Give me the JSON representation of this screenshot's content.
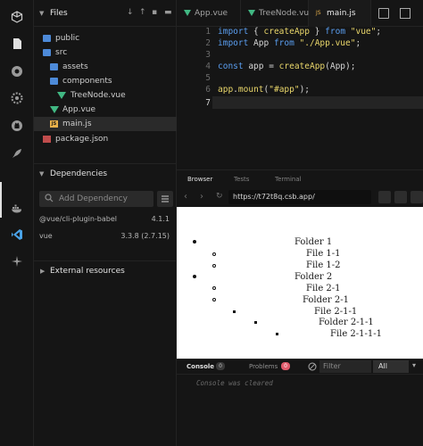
{
  "activity_bar": {
    "icons": [
      "cube-icon",
      "file-icon",
      "search-icon",
      "settings-icon",
      "github-icon",
      "rocket-icon",
      "docker-icon",
      "vscode-icon",
      "sparkle-icon"
    ]
  },
  "sidebar": {
    "title": "Files",
    "tree": [
      {
        "label": "public",
        "type": "folder"
      },
      {
        "label": "src",
        "type": "folder"
      },
      {
        "label": "assets",
        "type": "folder"
      },
      {
        "label": "components",
        "type": "folder"
      },
      {
        "label": "TreeNode.vue",
        "type": "vue"
      },
      {
        "label": "App.vue",
        "type": "vue"
      },
      {
        "label": "main.js",
        "type": "js"
      },
      {
        "label": "package.json",
        "type": "json"
      }
    ],
    "dependencies_title": "Dependencies",
    "add_dependency_placeholder": "Add Dependency",
    "dependencies": [
      {
        "name": "@vue/cli-plugin-babel",
        "version": "4.1.1"
      },
      {
        "name": "vue",
        "version": "3.3.8 (2.7.15)"
      }
    ],
    "external_resources_title": "External resources"
  },
  "editor": {
    "tabs": [
      {
        "label": "App.vue",
        "icon": "vue"
      },
      {
        "label": "TreeNode.vue",
        "icon": "vue"
      },
      {
        "label": "main.js",
        "icon": "js",
        "active": true
      }
    ],
    "line_numbers": [
      "1",
      "2",
      "3",
      "4",
      "5",
      "6",
      "7"
    ],
    "code": {
      "l1_kw": "import",
      "l1_mid": " { ",
      "l1_fn": "createApp",
      "l1_end": " } ",
      "l1_from": "from",
      "l1_str": " \"vue\"",
      "l1_semi": ";",
      "l2_kw": "import",
      "l2_mid": " App ",
      "l2_from": "from",
      "l2_str": " \"./App.vue\"",
      "l2_semi": ";",
      "l4_kw": "const",
      "l4_mid": " app = ",
      "l4_fn": "createApp",
      "l4_end": "(App);",
      "l6_obj": "app",
      "l6_dot": ".",
      "l6_fn": "mount",
      "l6_open": "(",
      "l6_str": "\"#app\"",
      "l6_close": ");"
    }
  },
  "preview": {
    "tabs": [
      "Browser",
      "Tests",
      "Terminal"
    ],
    "url": "https://t72t8q.csb.app/",
    "tree": [
      {
        "label": "Folder 1",
        "level": 0
      },
      {
        "label": "File 1-1",
        "level": 1
      },
      {
        "label": "File 1-2",
        "level": 1
      },
      {
        "label": "Folder 2",
        "level": 0
      },
      {
        "label": "File 2-1",
        "level": 1
      },
      {
        "label": "Folder 2-1",
        "level": 1
      },
      {
        "label": "File 2-1-1",
        "level": 2
      },
      {
        "label": "Folder 2-1-1",
        "level": 2
      },
      {
        "label": "File 2-1-1-1",
        "level": 3
      }
    ]
  },
  "console": {
    "tab_console": "Console",
    "console_count": "0",
    "tab_problems": "Problems",
    "problems_count": "0",
    "filter_placeholder": "Filter",
    "level_label": "All",
    "message": "Console was cleared"
  }
}
